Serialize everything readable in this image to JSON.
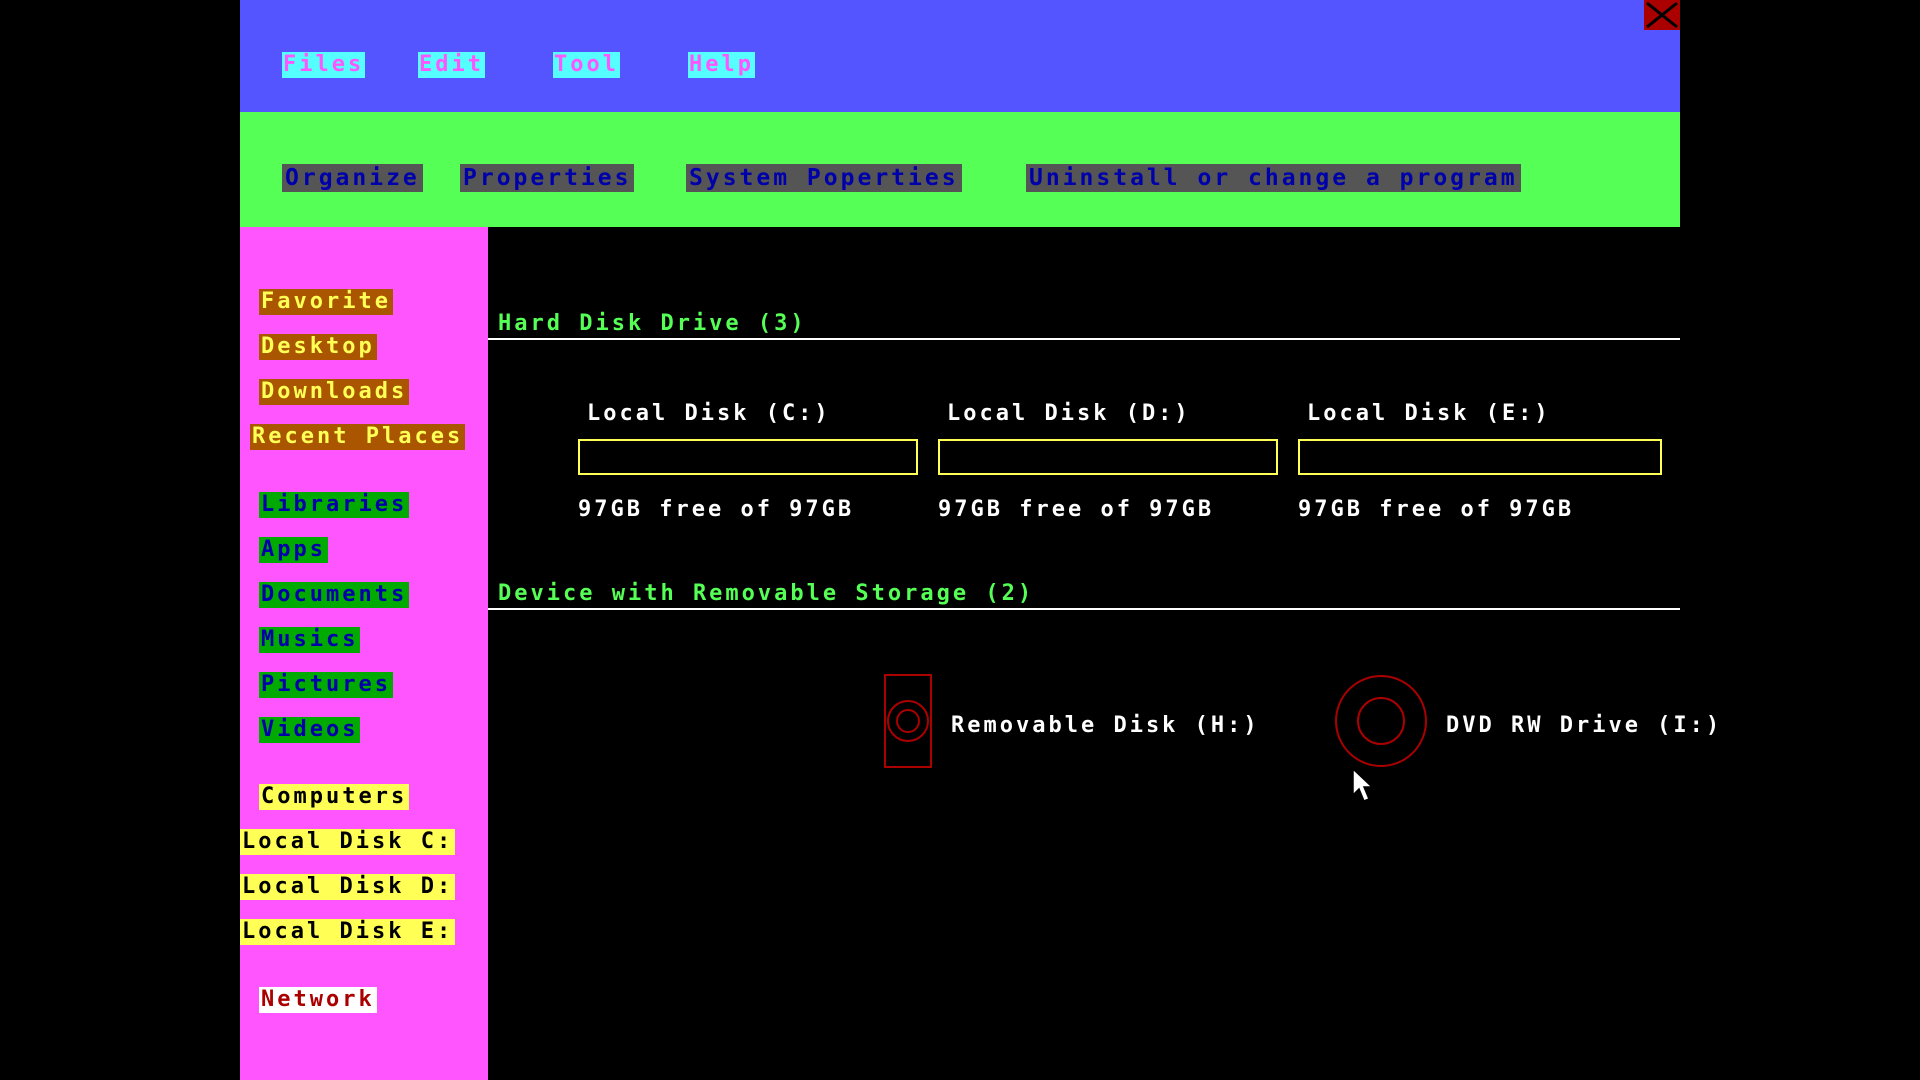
{
  "menubar": {
    "items": [
      {
        "label": "Files"
      },
      {
        "label": "Edit"
      },
      {
        "label": "Tool"
      },
      {
        "label": "Help"
      }
    ],
    "close_icon": "close-icon"
  },
  "toolbar": {
    "items": [
      {
        "label": "Organize"
      },
      {
        "label": "Properties"
      },
      {
        "label": "System Poperties"
      },
      {
        "label": "Uninstall or change a program"
      }
    ]
  },
  "sidebar": {
    "favorites": [
      {
        "label": "Favorite"
      },
      {
        "label": "Desktop"
      },
      {
        "label": "Downloads"
      },
      {
        "label": "Recent Places"
      }
    ],
    "libraries": [
      {
        "label": "Libraries"
      },
      {
        "label": "Apps"
      },
      {
        "label": "Documents"
      },
      {
        "label": "Musics"
      },
      {
        "label": "Pictures"
      },
      {
        "label": "Videos"
      }
    ],
    "computers": [
      {
        "label": "Computers"
      },
      {
        "label": "Local Disk C:"
      },
      {
        "label": "Local Disk D:"
      },
      {
        "label": "Local Disk E:"
      }
    ],
    "network": {
      "label": "Network"
    }
  },
  "main": {
    "hard_disks": {
      "title": "Hard Disk Drive (3)",
      "disks": [
        {
          "name": "Local Disk (C:)",
          "free_text": "97GB free of 97GB",
          "used_fraction": 0
        },
        {
          "name": "Local Disk (D:)",
          "free_text": "97GB free of 97GB",
          "used_fraction": 0
        },
        {
          "name": "Local Disk (E:)",
          "free_text": "97GB free of 97GB",
          "used_fraction": 0
        }
      ]
    },
    "removable": {
      "title": "Device with Removable Storage (2)",
      "devices": [
        {
          "name": "Removable Disk (H:)",
          "icon": "usb-drive-icon"
        },
        {
          "name": "DVD RW Drive (I:)",
          "icon": "optical-disc-icon"
        }
      ]
    }
  },
  "colors": {
    "menubar_bg": "#5555ff",
    "toolbar_bg": "#55ff55",
    "sidebar_bg": "#ff55ff",
    "main_bg": "#000000",
    "section_title": "#55ff55",
    "disk_bar_border": "#ffff55",
    "device_icon": "#aa0000"
  }
}
